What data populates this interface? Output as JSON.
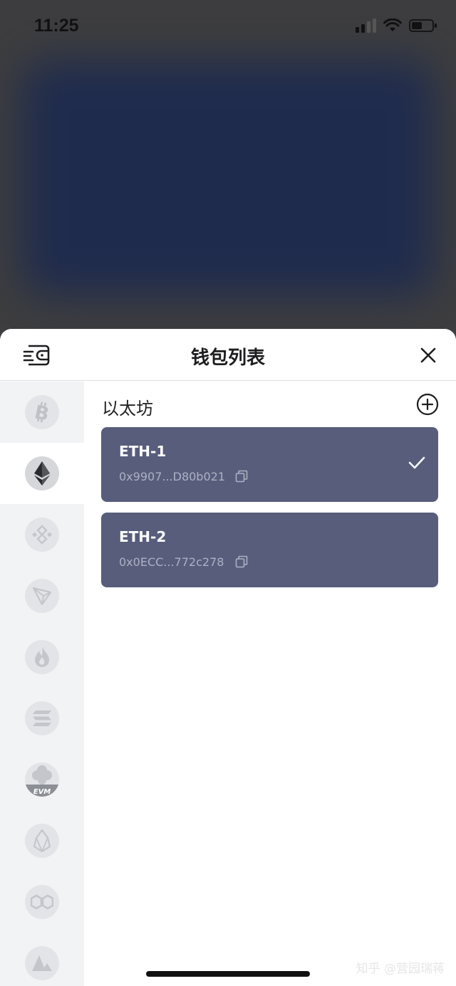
{
  "status_bar": {
    "time": "11:25"
  },
  "sheet": {
    "title": "钱包列表",
    "section_title": "以太坊",
    "wallets": [
      {
        "name": "ETH-1",
        "address": "0x9907...D80b021",
        "selected": true
      },
      {
        "name": "ETH-2",
        "address": "0x0ECC...772c278",
        "selected": false
      }
    ]
  },
  "chains": [
    {
      "icon": "bitcoin-icon"
    },
    {
      "icon": "ethereum-icon",
      "active": true
    },
    {
      "icon": "bnb-icon"
    },
    {
      "icon": "tron-icon"
    },
    {
      "icon": "heco-flame-icon"
    },
    {
      "icon": "solana-icon"
    },
    {
      "icon": "evm-icon",
      "label": "EVM"
    },
    {
      "icon": "eos-icon"
    },
    {
      "icon": "polygon-icon"
    },
    {
      "icon": "avalanche-icon"
    }
  ],
  "watermark": "知乎 @营园瑞蒋",
  "colors": {
    "card": "#575d7b",
    "sidebar": "#f2f3f5",
    "backdrop_blob": "#1e2b4e"
  }
}
